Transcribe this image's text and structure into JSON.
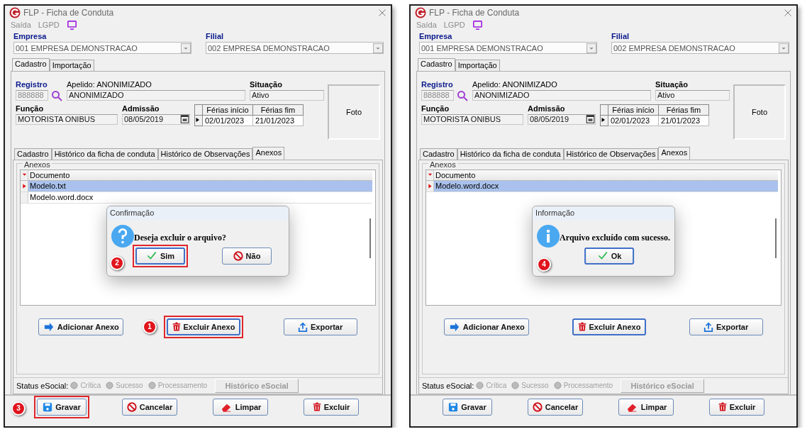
{
  "windows": [
    {
      "title": "FLP - Ficha de Conduta",
      "menu": [
        "Saída",
        "LGPD"
      ],
      "empresa": {
        "label": "Empresa",
        "value": "001 EMPRESA DEMONSTRACAO",
        "required": true
      },
      "filial": {
        "label": "Filial",
        "value": "002 EMPRESA DEMONSTRACAO",
        "required": true
      },
      "tabs": [
        {
          "label": "Cadastro",
          "selected": true
        },
        {
          "label": "Importação",
          "selected": false
        }
      ],
      "registro": {
        "label": "Registro",
        "value": "888888",
        "required": true,
        "disabled": true
      },
      "apelido": {
        "label": "Apelido: ANONIMIZADO",
        "value": "ANONIMIZADO"
      },
      "situacao": {
        "label": "Situação",
        "value": "Ativo",
        "required": false
      },
      "funcao": {
        "label": "Função",
        "value": "MOTORISTA ONIBUS",
        "required": false
      },
      "admissao": {
        "label": "Admissão",
        "value": "08/05/2019",
        "required": false
      },
      "ferias": {
        "columns": [
          "Férias início",
          "Férias fim"
        ],
        "rows": [
          [
            "02/01/2023",
            "21/01/2023"
          ]
        ]
      },
      "photo": "Foto",
      "inner_tabs": [
        {
          "label": "Cadastro",
          "selected": false
        },
        {
          "label": "Histórico da ficha de conduta",
          "selected": false
        },
        {
          "label": "Histórico de Observações",
          "selected": false
        },
        {
          "label": "Anexos",
          "selected": true
        }
      ],
      "anexos": {
        "title": "Anexos",
        "column": "Documento",
        "rows": [
          {
            "name": "Modelo.txt",
            "selected": true
          },
          {
            "name": "Modelo.word.docx",
            "selected": false
          }
        ]
      },
      "dialog": {
        "title": "Confirmação",
        "kind": "question",
        "message": "Deseja excluir o arquivo?",
        "buttons": [
          {
            "label": "Sim",
            "kind": "ok",
            "focused": true,
            "highlighted": true,
            "step": "2"
          },
          {
            "label": "Não",
            "kind": "cancel",
            "focused": false,
            "highlighted": false
          }
        ]
      },
      "actions": [
        {
          "label": "Adicionar Anexo",
          "kind": "add",
          "focused": false,
          "highlighted": false
        },
        {
          "label": "Excluir Anexo",
          "kind": "delete",
          "focused": true,
          "highlighted": true,
          "step": "1"
        },
        {
          "label": "Exportar",
          "kind": "export",
          "focused": false,
          "highlighted": false
        }
      ],
      "status": {
        "label": "Status eSocial:",
        "items": [
          "Crítica",
          "Sucesso",
          "Processamento"
        ],
        "history": "Histórico eSocial"
      },
      "footer": [
        {
          "label": "Gravar",
          "kind": "save",
          "focused": false,
          "highlighted": true,
          "step": "3"
        },
        {
          "label": "Cancelar",
          "kind": "cancel",
          "focused": false,
          "highlighted": false
        },
        {
          "label": "Limpar",
          "kind": "clear",
          "focused": false,
          "highlighted": false
        },
        {
          "label": "Excluir",
          "kind": "delete",
          "focused": false,
          "highlighted": false
        }
      ]
    },
    {
      "title": "FLP - Ficha de Conduta",
      "menu": [
        "Saída",
        "LGPD"
      ],
      "empresa": {
        "label": "Empresa",
        "value": "001 EMPRESA DEMONSTRACAO",
        "required": true
      },
      "filial": {
        "label": "Filial",
        "value": "002 EMPRESA DEMONSTRACAO",
        "required": true
      },
      "tabs": [
        {
          "label": "Cadastro",
          "selected": true
        },
        {
          "label": "Importação",
          "selected": false
        }
      ],
      "registro": {
        "label": "Registro",
        "value": "888888",
        "required": true,
        "disabled": true
      },
      "apelido": {
        "label": "Apelido: ANONIMIZADO",
        "value": "ANONIMIZADO"
      },
      "situacao": {
        "label": "Situação",
        "value": "Ativo",
        "required": false
      },
      "funcao": {
        "label": "Função",
        "value": "MOTORISTA ONIBUS",
        "required": false
      },
      "admissao": {
        "label": "Admissão",
        "value": "08/05/2019",
        "required": false
      },
      "ferias": {
        "columns": [
          "Férias início",
          "Férias fim"
        ],
        "rows": [
          [
            "02/01/2023",
            "21/01/2023"
          ]
        ]
      },
      "photo": "Foto",
      "inner_tabs": [
        {
          "label": "Cadastro",
          "selected": false
        },
        {
          "label": "Histórico da ficha de conduta",
          "selected": false
        },
        {
          "label": "Histórico de Observações",
          "selected": false
        },
        {
          "label": "Anexos",
          "selected": true
        }
      ],
      "anexos": {
        "title": "Anexos",
        "column": "Documento",
        "rows": [
          {
            "name": "Modelo.word.docx",
            "selected": true
          }
        ]
      },
      "dialog": {
        "title": "Informação",
        "kind": "info",
        "message": "Arquivo excluído com sucesso.",
        "step": "4",
        "buttons": [
          {
            "label": "Ok",
            "kind": "ok",
            "focused": true,
            "highlighted": false
          }
        ]
      },
      "actions": [
        {
          "label": "Adicionar Anexo",
          "kind": "add",
          "focused": false,
          "highlighted": false
        },
        {
          "label": "Excluir Anexo",
          "kind": "delete",
          "focused": true,
          "highlighted": false
        },
        {
          "label": "Exportar",
          "kind": "export",
          "focused": false,
          "highlighted": false
        }
      ],
      "status": {
        "label": "Status eSocial:",
        "items": [
          "Crítica",
          "Sucesso",
          "Processamento"
        ],
        "history": "Histórico eSocial"
      },
      "footer": [
        {
          "label": "Gravar",
          "kind": "save",
          "focused": false,
          "highlighted": false
        },
        {
          "label": "Cancelar",
          "kind": "cancel",
          "focused": false,
          "highlighted": false
        },
        {
          "label": "Limpar",
          "kind": "clear",
          "focused": false,
          "highlighted": false
        },
        {
          "label": "Excluir",
          "kind": "delete",
          "focused": false,
          "highlighted": false
        }
      ]
    }
  ]
}
